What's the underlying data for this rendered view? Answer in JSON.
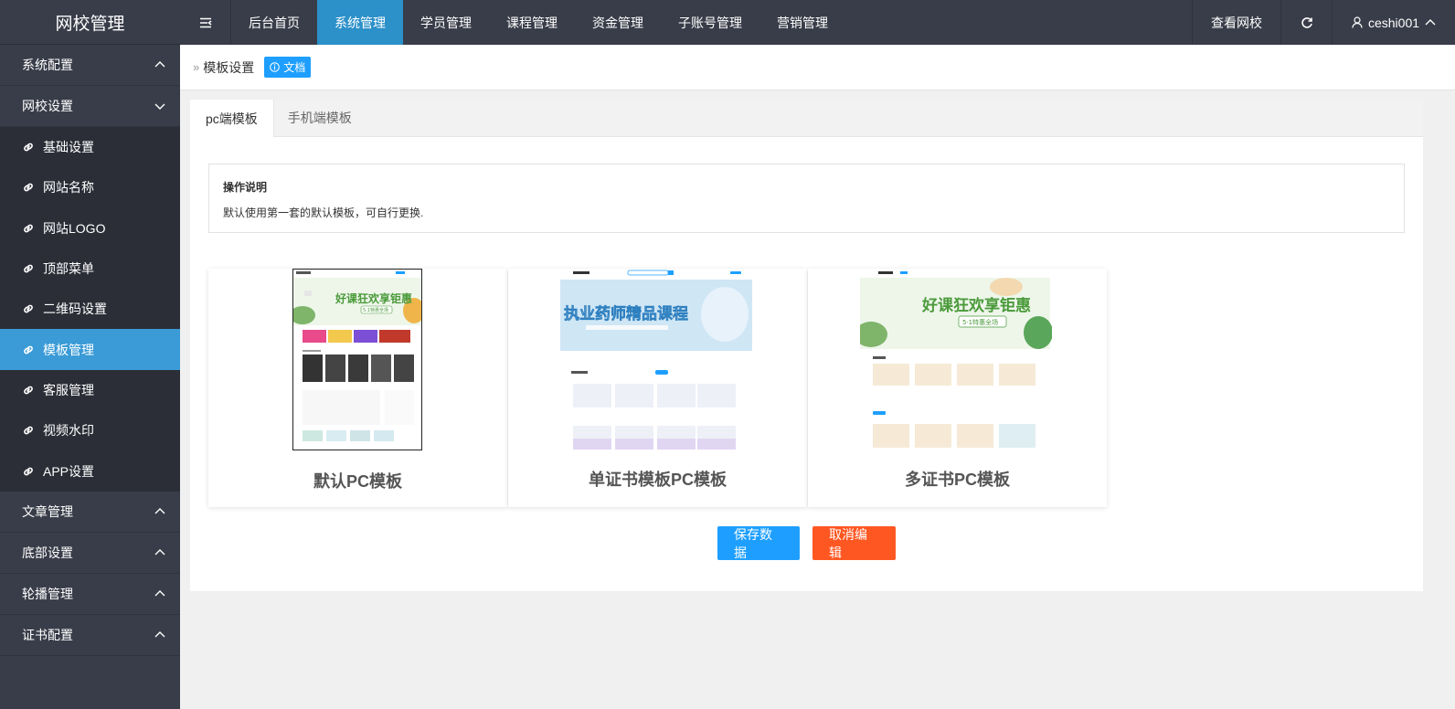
{
  "app": {
    "title": "网校管理"
  },
  "topnav": {
    "items": [
      {
        "label": "后台首页"
      },
      {
        "label": "系统管理"
      },
      {
        "label": "学员管理"
      },
      {
        "label": "课程管理"
      },
      {
        "label": "资金管理"
      },
      {
        "label": "子账号管理"
      },
      {
        "label": "营销管理"
      }
    ],
    "view_site": "查看网校",
    "username": "ceshi001"
  },
  "sidebar": {
    "groups": [
      {
        "label": "系统配置"
      },
      {
        "label": "网校设置"
      },
      {
        "label": "文章管理"
      },
      {
        "label": "底部设置"
      },
      {
        "label": "轮播管理"
      },
      {
        "label": "证书配置"
      }
    ],
    "sub_items": [
      {
        "label": "基础设置"
      },
      {
        "label": "网站名称"
      },
      {
        "label": "网站LOGO"
      },
      {
        "label": "顶部菜单"
      },
      {
        "label": "二维码设置"
      },
      {
        "label": "模板管理"
      },
      {
        "label": "客服管理"
      },
      {
        "label": "视频水印"
      },
      {
        "label": "APP设置"
      }
    ]
  },
  "breadcrumb": {
    "current": "模板设置",
    "doc_label": "文档"
  },
  "tabs": [
    {
      "label": "pc端模板"
    },
    {
      "label": "手机端模板"
    }
  ],
  "notice": {
    "title": "操作说明",
    "desc": "默认使用第一套的默认模板，可自行更换."
  },
  "templates": [
    {
      "name": "默认PC模板",
      "banner_text": "好课狂欢享钜惠",
      "banner_sub": "5·1特惠全场"
    },
    {
      "name": "单证书模板PC模板",
      "banner_text": "执业药师精品课程"
    },
    {
      "name": "多证书PC模板",
      "banner_text": "好课狂欢享钜惠",
      "banner_sub": "5·1特惠全场"
    }
  ],
  "actions": {
    "save": "保存数据",
    "cancel": "取消编辑"
  },
  "colors": {
    "sidebar_bg": "#393d49",
    "active_blue": "#3a9bd6",
    "save": "#1e9fff",
    "cancel": "#ff5722"
  }
}
